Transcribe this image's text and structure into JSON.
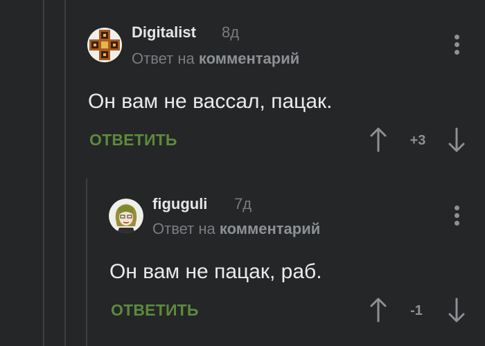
{
  "comments": [
    {
      "username": "Digitalist",
      "time": "8д",
      "reply_prefix": "Ответ на",
      "reply_target": "комментарий",
      "text": "Он вам не вассал, пацак.",
      "reply_label": "ОТВЕТИТЬ",
      "score": "+3"
    },
    {
      "username": "figuguli",
      "time": "7д",
      "reply_prefix": "Ответ на",
      "reply_target": "комментарий",
      "text": "Он вам не пацак, раб.",
      "reply_label": "ОТВЕТИТЬ",
      "score": "-1"
    }
  ],
  "icons": {
    "menu": "kebab-menu-icon",
    "upvote": "arrow-up-icon",
    "downvote": "arrow-down-icon"
  },
  "colors": {
    "background": "#242628",
    "username": "#e4e6e8",
    "meta": "#7a7d80",
    "reply_button": "#5d8a3c",
    "text": "#e9ebed"
  }
}
